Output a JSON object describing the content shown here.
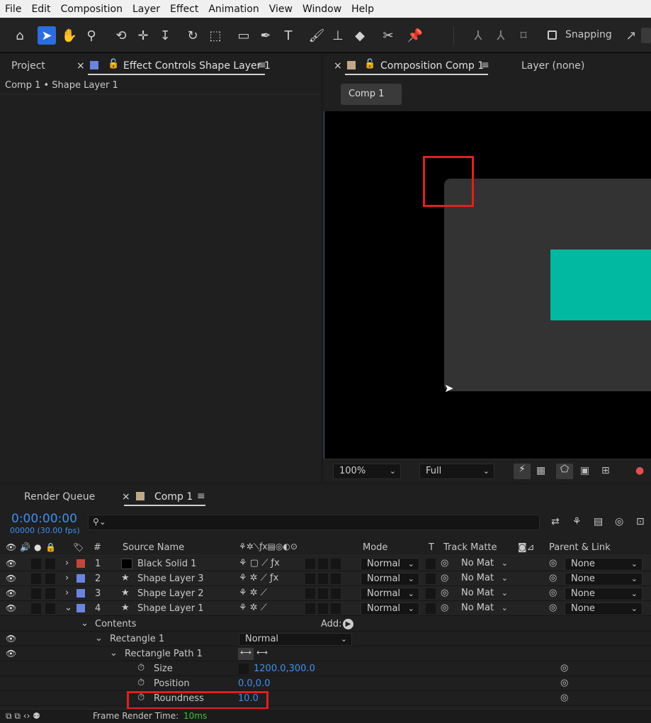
{
  "menu": [
    "File",
    "Edit",
    "Composition",
    "Layer",
    "Effect",
    "Animation",
    "View",
    "Window",
    "Help"
  ],
  "toolbar": {
    "snapping_label": "Snapping"
  },
  "left_panel": {
    "tab_project": "Project",
    "tab_effect_controls": "Effect Controls Shape Layer 1",
    "breadcrumb": "Comp 1 • Shape Layer 1",
    "close": "×"
  },
  "comp_panel": {
    "close": "×",
    "tab_composition": "Composition Comp 1",
    "tab_layer": "Layer (none)",
    "comp_button": "Comp 1",
    "zoom": "100%",
    "resolution": "Full",
    "colors": {
      "shape_gray": "#333333",
      "teal": "#00b9a0",
      "highlight": "#e02020"
    }
  },
  "timeline": {
    "tab_render_queue": "Render Queue",
    "tab_comp": "Comp 1",
    "close": "×",
    "timecode": "0:00:00:00",
    "frames": "00000 (30.00 fps)",
    "search_placeholder": "",
    "headers": {
      "num": "#",
      "source_name": "Source Name",
      "mode": "Mode",
      "t": "T",
      "track_matte": "Track Matte",
      "parent_link": "Parent & Link"
    },
    "layers": [
      {
        "num": "1",
        "name": "Black Solid 1",
        "color": "#c4463a",
        "mode": "Normal",
        "matte": "No Mat",
        "parent": "None"
      },
      {
        "num": "2",
        "name": "Shape Layer 3",
        "color": "#6b84e0",
        "mode": "Normal",
        "matte": "No Mat",
        "parent": "None"
      },
      {
        "num": "3",
        "name": "Shape Layer 2",
        "color": "#6b84e0",
        "mode": "Normal",
        "matte": "No Mat",
        "parent": "None"
      },
      {
        "num": "4",
        "name": "Shape Layer 1",
        "color": "#6b84e0",
        "mode": "Normal",
        "matte": "No Mat",
        "parent": "None"
      }
    ],
    "contents_label": "Contents",
    "add_label": "Add:",
    "rectangle_label": "Rectangle 1",
    "rectangle_mode": "Normal",
    "rect_path_label": "Rectangle Path 1",
    "props": {
      "size_label": "Size",
      "size_value": "1200.0,300.0",
      "position_label": "Position",
      "position_value": "0.0,0.0",
      "roundness_label": "Roundness",
      "roundness_value": "10.0"
    },
    "frame_render_label": "Frame Render Time:",
    "frame_render_value": "10ms"
  }
}
